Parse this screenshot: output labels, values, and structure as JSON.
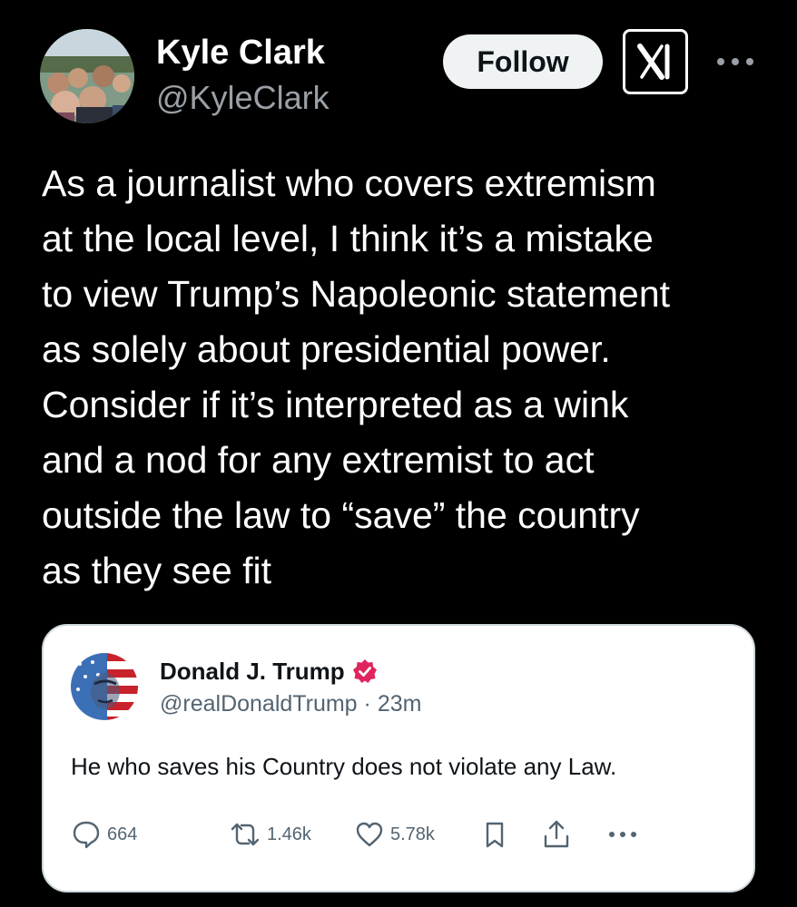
{
  "post": {
    "author_name": "Kyle Clark",
    "author_handle": "@KyleClark",
    "follow_label": "Follow",
    "text_lines": [
      "As a journalist who covers extremism",
      "at the local level, I think it’s a mistake",
      "to view Trump’s Napoleonic statement",
      "as solely about presidential power.",
      "Consider if it’s interpreted as a wink",
      "and a nod for any extremist to act",
      "outside the law to “save” the country",
      "as they see fit"
    ]
  },
  "quote": {
    "author_name": "Donald J. Trump",
    "author_handle": "@realDonaldTrump",
    "separator": " · ",
    "time": "23m",
    "text": "He who saves his Country does not violate any Law.",
    "actions": {
      "replies": "664",
      "reposts": "1.46k",
      "likes": "5.78k"
    }
  },
  "icons": {
    "x_logo": "x-logo-icon",
    "more": "more-horizontal-icon",
    "verified": "verified-badge-icon",
    "reply": "reply-icon",
    "repost": "repost-icon",
    "like": "heart-icon",
    "bookmark": "bookmark-icon",
    "share": "share-icon"
  },
  "colors": {
    "background": "#000000",
    "text": "#ffffff",
    "secondary_text": "#9aa0a6",
    "follow_button_bg": "#eff3f4",
    "verified_badge": "#e0245e",
    "quote_bg": "#ffffff",
    "quote_meta": "#536471"
  }
}
